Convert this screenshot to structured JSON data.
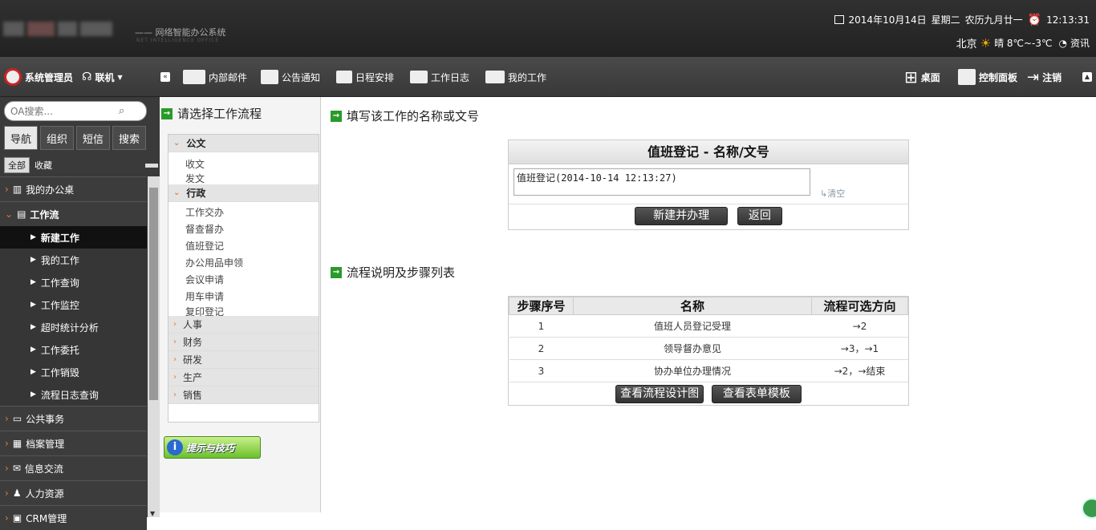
{
  "header": {
    "tagline": "—— 网络智能办公系统",
    "tagline_en": "NET INTELLIGENCE OFFICE",
    "date": "2014年10月14日",
    "weekday": "星期二",
    "lunar": "农历九月廿一",
    "time": "12:13:31",
    "city": "北京",
    "weather": "晴 8℃~-3℃",
    "rss": "资讯"
  },
  "toolbar": {
    "user": "系统管理员",
    "status": "联机",
    "items": [
      "内部邮件",
      "公告通知",
      "日程安排",
      "工作日志",
      "我的工作"
    ],
    "right": [
      "桌面",
      "控制面板",
      "注销"
    ]
  },
  "sidebar": {
    "search_placeholder": "OA搜索...",
    "tabs": [
      "导航",
      "组织",
      "短信",
      "搜索"
    ],
    "sub_all": "全部",
    "sub_fav": "收藏",
    "items": [
      {
        "label": "我的办公桌"
      },
      {
        "label": "工作流"
      }
    ],
    "sub_items": [
      "新建工作",
      "我的工作",
      "工作查询",
      "工作监控",
      "超时统计分析",
      "工作委托",
      "工作销毁",
      "流程日志查询"
    ],
    "more": [
      "公共事务",
      "档案管理",
      "信息交流",
      "人力资源",
      "CRM管理"
    ]
  },
  "flow": {
    "title": "请选择工作流程",
    "cat1": "公文",
    "cat1_items": [
      "收文",
      "发文"
    ],
    "cat2": "行政",
    "cat2_items": [
      "工作交办",
      "督查督办",
      "值班登记",
      "办公用品申领",
      "会议申请",
      "用车申请",
      "复印登记"
    ],
    "closed": [
      "人事",
      "财务",
      "研发",
      "生产",
      "销售"
    ],
    "tip": "提示与技巧"
  },
  "form": {
    "section_title": "填写该工作的名称或文号",
    "card_title": "值班登记 - 名称/文号",
    "value": "值班登记(2014-10-14 12:13:27)",
    "clear": "清空",
    "create": "新建并办理",
    "back": "返回"
  },
  "steps": {
    "section_title": "流程说明及步骤列表",
    "headers": [
      "步骤序号",
      "名称",
      "流程可选方向"
    ],
    "rows": [
      [
        "1",
        "值班人员登记受理",
        "→2"
      ],
      [
        "2",
        "领导督办意见",
        "→3，→1"
      ],
      [
        "3",
        "协办单位办理情况",
        "→2，→结束"
      ]
    ],
    "btn_design": "查看流程设计图",
    "btn_form": "查看表单模板"
  },
  "colors": {
    "accent_green": "#2a9a2a",
    "dark_bar": "#3a3a3a"
  }
}
